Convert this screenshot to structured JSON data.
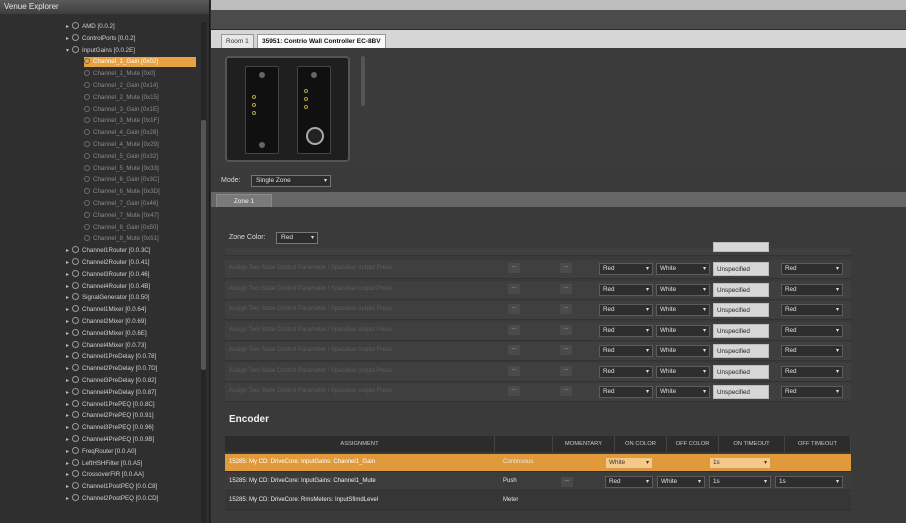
{
  "left_panel": {
    "title": "Venue Explorer",
    "tree": [
      {
        "label": "AMD [0.0.2]",
        "level": 0,
        "toggle": "▸"
      },
      {
        "label": "ControlPorts [0.0.2]",
        "level": 0,
        "toggle": "▸"
      },
      {
        "label": "InputGains [0.0.2E]",
        "level": 0,
        "toggle": "▾"
      },
      {
        "label": "Channel_1_Gain [0x02]",
        "level": 1,
        "selected": true
      },
      {
        "label": "Channel_1_Mute [0x0]",
        "level": 1
      },
      {
        "label": "Channel_2_Gain [0x14]",
        "level": 1
      },
      {
        "label": "Channel_2_Mute [0x15]",
        "level": 1
      },
      {
        "label": "Channel_3_Gain [0x1E]",
        "level": 1
      },
      {
        "label": "Channel_3_Mute [0x1F]",
        "level": 1
      },
      {
        "label": "Channel_4_Gain [0x28]",
        "level": 1
      },
      {
        "label": "Channel_4_Mute [0x29]",
        "level": 1
      },
      {
        "label": "Channel_5_Gain [0x32]",
        "level": 1
      },
      {
        "label": "Channel_5_Mute [0x33]",
        "level": 1
      },
      {
        "label": "Channel_6_Gain [0x3C]",
        "level": 1
      },
      {
        "label": "Channel_6_Mute [0x3D]",
        "level": 1
      },
      {
        "label": "Channel_7_Gain [0x46]",
        "level": 1
      },
      {
        "label": "Channel_7_Mute [0x47]",
        "level": 1
      },
      {
        "label": "Channel_8_Gain [0x50]",
        "level": 1
      },
      {
        "label": "Channel_8_Mute [0x51]",
        "level": 1
      },
      {
        "label": "Channel1Router [0.0.3C]",
        "level": 0,
        "toggle": "▸"
      },
      {
        "label": "Channel2Router [0.0.41]",
        "level": 0,
        "toggle": "▸"
      },
      {
        "label": "Channel3Router [0.0.46]",
        "level": 0,
        "toggle": "▸"
      },
      {
        "label": "Channel4Router [0.0.4B]",
        "level": 0,
        "toggle": "▸"
      },
      {
        "label": "SignalGenerator [0.0.50]",
        "level": 0,
        "toggle": "▸"
      },
      {
        "label": "Channel1Mixer [0.0.64]",
        "level": 0,
        "toggle": "▸"
      },
      {
        "label": "Channel2Mixer [0.0.69]",
        "level": 0,
        "toggle": "▸"
      },
      {
        "label": "Channel3Mixer [0.0.6E]",
        "level": 0,
        "toggle": "▸"
      },
      {
        "label": "Channel4Mixer [0.0.73]",
        "level": 0,
        "toggle": "▸"
      },
      {
        "label": "Channel1PreDelay [0.0.78]",
        "level": 0,
        "toggle": "▸"
      },
      {
        "label": "Channel2PreDelay [0.0.7D]",
        "level": 0,
        "toggle": "▸"
      },
      {
        "label": "Channel3PreDelay [0.0.82]",
        "level": 0,
        "toggle": "▸"
      },
      {
        "label": "Channel4PreDelay [0.0.87]",
        "level": 0,
        "toggle": "▸"
      },
      {
        "label": "Channel1PrePEQ [0.0.8C]",
        "level": 0,
        "toggle": "▸"
      },
      {
        "label": "Channel2PrePEQ [0.0.91]",
        "level": 0,
        "toggle": "▸"
      },
      {
        "label": "Channel3PrePEQ [0.0.96]",
        "level": 0,
        "toggle": "▸"
      },
      {
        "label": "Channel4PrePEQ [0.0.9B]",
        "level": 0,
        "toggle": "▸"
      },
      {
        "label": "FreqRouter [0.0.A0]",
        "level": 0,
        "toggle": "▸"
      },
      {
        "label": "LeftHSHFilter [0.0.A5]",
        "level": 0,
        "toggle": "▸"
      },
      {
        "label": "CrossoverFIR [0.0.AA]",
        "level": 0,
        "toggle": "▸"
      },
      {
        "label": "Channel1PostPEQ [0.0.C8]",
        "level": 0,
        "toggle": "▸"
      },
      {
        "label": "Channel2PostPEQ [0.0.CD]",
        "level": 0,
        "toggle": "▸"
      }
    ]
  },
  "tabs": [
    {
      "label": "Room 1"
    },
    {
      "label": "35951: Contrio Wall Controller EC-8BV"
    }
  ],
  "mode": {
    "label": "Mode:",
    "value": "Single Zone"
  },
  "zone_tab": "Zone 1",
  "zone_color": {
    "label": "Zone Color:",
    "value": "Red"
  },
  "button_rows": [
    {
      "desc": "Assign Two State Control Parameter / Spacebar output Press",
      "on_color": "Red",
      "off_color": "White",
      "timeout": "Unspecified",
      "color2": "Red"
    },
    {
      "desc": "Assign Two State Control Parameter / Spacebar output Press",
      "on_color": "Red",
      "off_color": "White",
      "timeout": "Unspecified",
      "color2": "Red"
    },
    {
      "desc": "Assign Two State Control Parameter / Spacebar output Press",
      "on_color": "Red",
      "off_color": "White",
      "timeout": "Unspecified",
      "color2": "Red"
    },
    {
      "desc": "Assign Two State Control Parameter / Spacebar output Press",
      "on_color": "Red",
      "off_color": "White",
      "timeout": "Unspecified",
      "color2": "Red"
    },
    {
      "desc": "Assign Two State Control Parameter / Spacebar output Press",
      "on_color": "Red",
      "off_color": "White",
      "timeout": "Unspecified",
      "color2": "Red"
    },
    {
      "desc": "Assign Two State Control Parameter / Spacebar output Press",
      "on_color": "Red",
      "off_color": "White",
      "timeout": "Unspecified",
      "color2": "Red"
    },
    {
      "desc": "Assign Two State Control Parameter / Spacebar output Press",
      "on_color": "Red",
      "off_color": "White",
      "timeout": "Unspecified",
      "color2": "Red"
    }
  ],
  "encoder": {
    "title": "Encoder",
    "headers": [
      "ASSIGNMENT",
      "",
      "MOMENTARY",
      "ON COLOR",
      "OFF COLOR",
      "ON TIMEOUT",
      "OFF TIMEOUT"
    ],
    "rows": [
      {
        "assignment": "15285: My CD: DriveCore: InputGains: Channel1_Gain",
        "type": "Continuous",
        "on_color": "White",
        "off_color": "",
        "on_timeout": "1s",
        "off_timeout": ""
      },
      {
        "assignment": "15285: My CD: DriveCore: InputGains: Channel1_Mute",
        "type": "Push",
        "on_color": "Red",
        "off_color": "White",
        "on_timeout": "1s",
        "off_timeout": "1s"
      },
      {
        "assignment": "15285: My CD: DriveCore: RmsMeters: InputSfimdLevel",
        "type": "Meter",
        "on_color": "",
        "off_color": "",
        "on_timeout": "",
        "off_timeout": ""
      }
    ]
  },
  "colors": {
    "selection": "#e8a241",
    "panel_bg": "#3a3a3a"
  }
}
